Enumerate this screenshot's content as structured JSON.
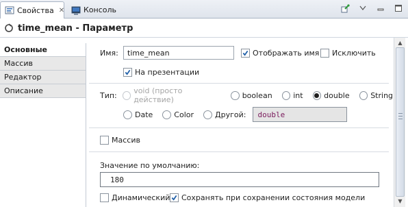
{
  "tabs": {
    "active": {
      "label": "Свойства",
      "icon": "properties-icon"
    },
    "inactive": {
      "label": "Консоль",
      "icon": "console-icon"
    }
  },
  "toolbar": {
    "icons": [
      "pin-icon",
      "view-menu-icon",
      "minimize-icon",
      "maximize-icon"
    ]
  },
  "header": {
    "title": "time_mean - Параметр",
    "icon": "parameter-icon"
  },
  "sidebar": {
    "items": [
      {
        "label": "Основные",
        "active": true
      },
      {
        "label": "Массив",
        "active": false
      },
      {
        "label": "Редактор",
        "active": false
      },
      {
        "label": "Описание",
        "active": false
      }
    ]
  },
  "form": {
    "name_label": "Имя:",
    "name_value": "time_mean",
    "show_name_label": "Отображать имя",
    "show_name_checked": true,
    "exclude_label": "Исключить",
    "exclude_checked": false,
    "on_presentation_label": "На презентации",
    "on_presentation_checked": true,
    "type_label": "Тип:",
    "types": {
      "void": "void (просто действие)",
      "boolean": "boolean",
      "int": "int",
      "double": "double",
      "string": "String",
      "date": "Date",
      "color": "Color",
      "other": "Другой:"
    },
    "selected_type": "double",
    "other_type_value": "double",
    "array_label": "Массив",
    "array_checked": false,
    "default_value_label": "Значение по умолчанию:",
    "default_value": "180",
    "dynamic_label": "Динамический",
    "dynamic_checked": false,
    "save_state_label": "Сохранять при сохранении состояния модели",
    "save_state_checked": true
  },
  "colors": {
    "accent": "#1f5fa8",
    "tab_border": "#a9b4c4",
    "code_text": "#7a1a5c"
  }
}
